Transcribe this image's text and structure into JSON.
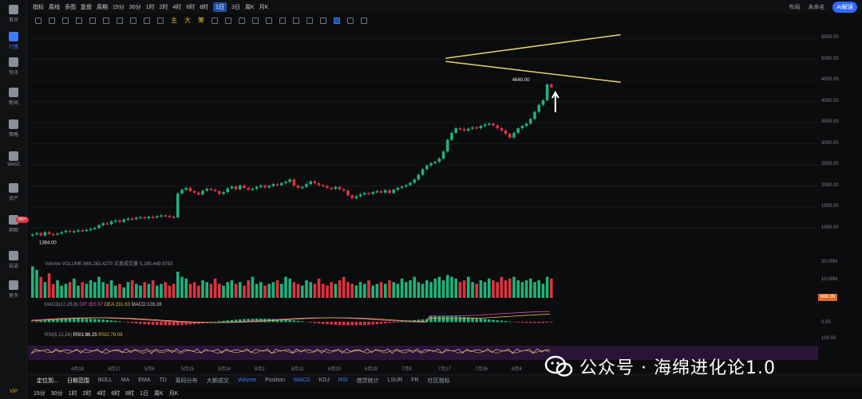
{
  "sidebar": {
    "items": [
      {
        "label": "首页"
      },
      {
        "label": "行情"
      },
      {
        "label": "快讯"
      },
      {
        "label": "新闻"
      },
      {
        "label": "策略"
      },
      {
        "label": "Web3"
      },
      {
        "label": "资产"
      },
      {
        "label": "群聊"
      },
      {
        "label": "自选"
      },
      {
        "label": "更多"
      }
    ],
    "badge": "99+",
    "vip": "VIP"
  },
  "topbar": {
    "items": [
      "指标",
      "周线",
      "多图",
      "复盘",
      "周期",
      "15分",
      "30分",
      "1时",
      "2时",
      "4时",
      "6时",
      "8时",
      "1日",
      "3日",
      "周K",
      "月K"
    ],
    "active": "1日",
    "right": {
      "layout": "布局",
      "account": "未命名",
      "ai": "AI解读"
    }
  },
  "toolbar2": {
    "tools": [
      "主",
      "大",
      "筹"
    ]
  },
  "price_axis": [
    "5500.00",
    "5000.00",
    "4500.00",
    "4000.00",
    "3500.00",
    "3000.00",
    "2500.00",
    "2000.00",
    "1500.00",
    "1000.00"
  ],
  "vol_axis": [
    "20.00M",
    "10.00M"
  ],
  "macd_axis": [
    "0.00"
  ],
  "rsi_axis": [
    "100.00"
  ],
  "price_tag": "668.36",
  "annotations": {
    "high": "4640.00",
    "low": "1384.00"
  },
  "panes": {
    "volume": "Volume VOLUME:668,263.4270  买卖成交量  5,285,449.9783",
    "macd_name": "MACD(12,26,9)",
    "macd_dif": "DIF:355.97",
    "macd_dea": "DEA:231.63",
    "macd_val": "MACD:128.28",
    "rsi_name": "RSI(6,12,24)",
    "rsi1": "RSI1:86.25",
    "rsi2": "RSI2:79.09"
  },
  "dates": [
    "4月18",
    "4月27",
    "5月6",
    "5月15",
    "5月24",
    "6月2",
    "6月11",
    "6月20",
    "6月29",
    "7月8",
    "7月17",
    "7月26",
    "8月4"
  ],
  "indicator_bar": {
    "left": [
      "定位到...",
      "日期范围"
    ],
    "items": [
      "BOLL",
      "MA",
      "EMA",
      "TD",
      "筹码分布",
      "大额成交",
      "Volume",
      "Position",
      "MACD",
      "KDJ",
      "RSI",
      "借贷统计",
      "LSUR",
      "FR",
      "社区指标"
    ],
    "highlight": [
      "MACD",
      "RSI"
    ],
    "selected": [
      "Volume"
    ]
  },
  "bottom_bar": [
    "15分",
    "30分",
    "1时",
    "2时",
    "4时",
    "6时",
    "8时",
    "1日",
    "周K",
    "月K"
  ],
  "watermark": "公众号 · 海绵进化论1.0",
  "chart_data": {
    "type": "candlestick",
    "ylim": [
      1000,
      5700
    ],
    "up_color": "#1fb37a",
    "down_color": "#e0323f",
    "closes": [
      1420,
      1450,
      1400,
      1470,
      1430,
      1420,
      1440,
      1470,
      1500,
      1480,
      1490,
      1510,
      1495,
      1520,
      1540,
      1560,
      1620,
      1660,
      1640,
      1700,
      1720,
      1690,
      1740,
      1760,
      1750,
      1780,
      1790,
      1770,
      1800,
      1790,
      1810,
      1830,
      1820,
      1800,
      1790,
      2300,
      2380,
      2420,
      2350,
      2320,
      2280,
      2360,
      2400,
      2380,
      2350,
      2290,
      2330,
      2410,
      2450,
      2390,
      2470,
      2420,
      2380,
      2400,
      2440,
      2470,
      2430,
      2460,
      2500,
      2480,
      2520,
      2550,
      2600,
      2470,
      2420,
      2440,
      2500,
      2560,
      2520,
      2480,
      2460,
      2420,
      2400,
      2440,
      2390,
      2360,
      2260,
      2200,
      2240,
      2280,
      2310,
      2290,
      2330,
      2350,
      2320,
      2370,
      2310,
      2380,
      2420,
      2450,
      2480,
      2530,
      2600,
      2700,
      2820,
      2900,
      2950,
      2980,
      3050,
      3200,
      3450,
      3600,
      3700,
      3680,
      3650,
      3690,
      3720,
      3700,
      3750,
      3780,
      3800,
      3760,
      3700,
      3650,
      3580,
      3500,
      3600,
      3700,
      3750,
      3800,
      3900,
      4050,
      4200,
      4300,
      4640,
      4580
    ],
    "volume": [
      18,
      16,
      12,
      9,
      14,
      8,
      10,
      7,
      8,
      9,
      11,
      7,
      9,
      8,
      10,
      9,
      12,
      9,
      8,
      10,
      7,
      8,
      6,
      9,
      10,
      8,
      7,
      9,
      8,
      10,
      7,
      8,
      9,
      7,
      8,
      15,
      12,
      11,
      8,
      9,
      7,
      10,
      9,
      8,
      11,
      8,
      7,
      9,
      10,
      8,
      9,
      7,
      10,
      12,
      8,
      9,
      7,
      8,
      9,
      10,
      8,
      12,
      11,
      9,
      8,
      7,
      10,
      9,
      8,
      11,
      8,
      7,
      9,
      8,
      10,
      12,
      9,
      8,
      7,
      9,
      8,
      10,
      7,
      8,
      9,
      8,
      10,
      9,
      8,
      11,
      9,
      10,
      12,
      9,
      8,
      10,
      9,
      11,
      12,
      10,
      13,
      12,
      11,
      9,
      10,
      12,
      9,
      8,
      10,
      9,
      11,
      10,
      9,
      12,
      10,
      11,
      12,
      10,
      9,
      10,
      11,
      9,
      10,
      8,
      12,
      11
    ],
    "channel_upper": [
      [
        0.517,
        0.146
      ],
      [
        0.72,
        0.087
      ]
    ],
    "channel_lower": [
      [
        0.517,
        0.154
      ],
      [
        0.72,
        0.206
      ]
    ]
  }
}
